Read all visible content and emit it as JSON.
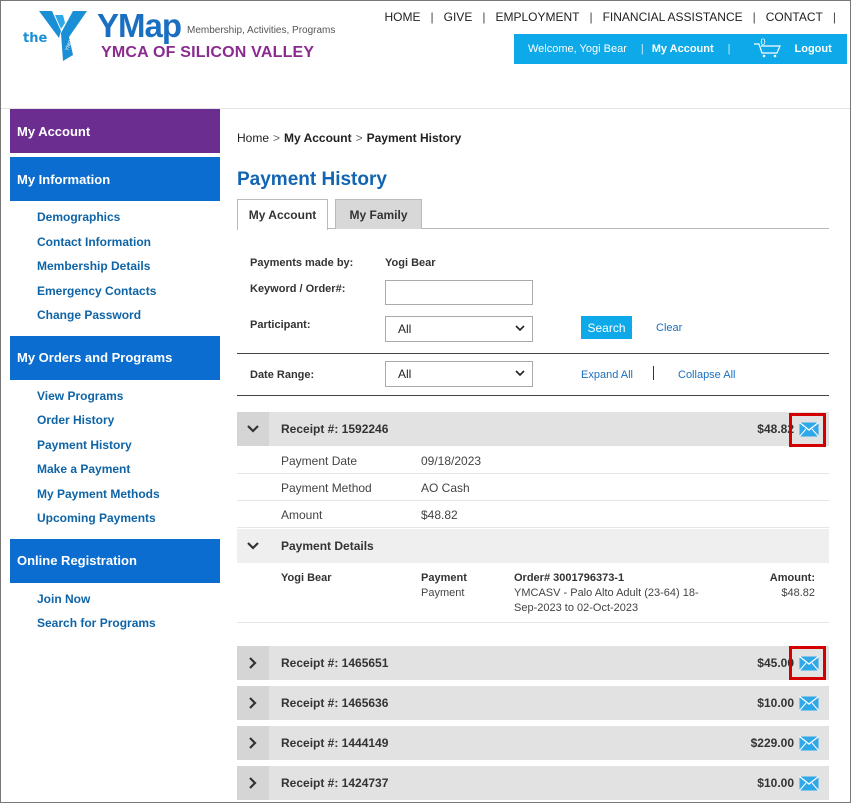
{
  "header": {
    "logo_the": "the",
    "logo_ymca": "YMCA",
    "app_name": "YMap",
    "tagline": "Membership, Activities, Programs",
    "org_name": "YMCA OF SILICON VALLEY",
    "nav": [
      "HOME",
      "GIVE",
      "EMPLOYMENT",
      "FINANCIAL ASSISTANCE",
      "CONTACT"
    ],
    "welcome": "Welcome, Yogi Bear",
    "my_account": "My Account",
    "cart_count": "0",
    "logout": "Logout"
  },
  "sidebar": {
    "my_account": "My Account",
    "sections": [
      {
        "title": "My Information",
        "items": [
          "Demographics",
          "Contact Information",
          "Membership Details",
          "Emergency Contacts",
          "Change Password"
        ]
      },
      {
        "title": "My Orders and Programs",
        "items": [
          "View Programs",
          "Order History",
          "Payment History",
          "Make a Payment",
          "My Payment Methods",
          "Upcoming Payments"
        ]
      },
      {
        "title": "Online Registration",
        "items": [
          "Join Now",
          "Search for Programs"
        ]
      }
    ]
  },
  "breadcrumb": {
    "home": "Home",
    "sep": ">",
    "account": "My Account",
    "current": "Payment History"
  },
  "page_title": "Payment History",
  "tabs": {
    "my_account": "My Account",
    "my_family": "My Family"
  },
  "filters": {
    "payments_made_by_label": "Payments made by:",
    "payments_made_by_value": "Yogi Bear",
    "keyword_label": "Keyword / Order#:",
    "keyword_value": "",
    "participant_label": "Participant:",
    "participant_value": "All",
    "search": "Search",
    "clear": "Clear",
    "date_range_label": "Date Range:",
    "date_range_value": "All",
    "expand_all": "Expand All",
    "collapse_all": "Collapse All"
  },
  "receipts": [
    {
      "number": "Receipt #: 1592246",
      "amount": "$48.82"
    },
    {
      "number": "Receipt #: 1465651",
      "amount": "$45.00"
    },
    {
      "number": "Receipt #: 1465636",
      "amount": "$10.00"
    },
    {
      "number": "Receipt #: 1444149",
      "amount": "$229.00"
    },
    {
      "number": "Receipt #: 1424737",
      "amount": "$10.00"
    }
  ],
  "receipt_detail": {
    "rows": [
      {
        "label": "Payment Date",
        "value": "09/18/2023"
      },
      {
        "label": "Payment Method",
        "value": "AO Cash"
      },
      {
        "label": "Amount",
        "value": "$48.82"
      }
    ],
    "payment_details_title": "Payment Details",
    "payer": "Yogi Bear",
    "type_bold": "Payment",
    "type": "Payment",
    "order": "Order# 3001796373-1",
    "desc_line1": "YMCASV - Palo Alto Adult (23-64) 18-",
    "desc_line2": "Sep-2023 to 02-Oct-2023",
    "amount_label": "Amount:",
    "amount_value": "$48.82"
  },
  "colors": {
    "brand_blue": "#0b6dd0",
    "purple": "#6c2d91",
    "accent": "#0da9e8",
    "link": "#0e64a6",
    "highlight": "#d40000"
  }
}
